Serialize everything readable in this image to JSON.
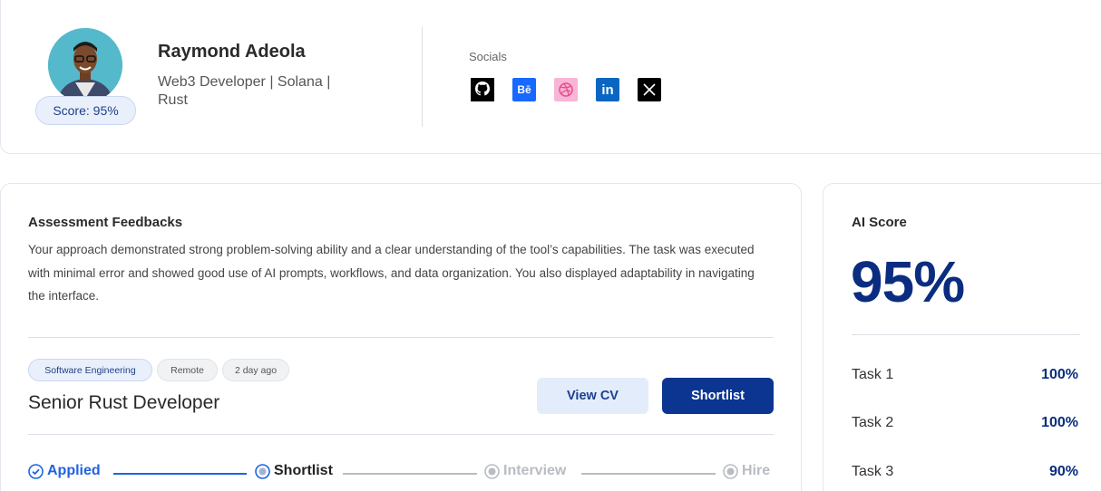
{
  "profile": {
    "name": "Raymond Adeola",
    "role": "Web3 Developer | Solana | Rust",
    "score_badge": "Score: 95%",
    "socials_label": "Socials",
    "socials": [
      "github-icon",
      "behance-icon",
      "dribbble-icon",
      "linkedin-icon",
      "x-icon"
    ],
    "behance_text": "Bē",
    "linkedin_text": "in"
  },
  "assessment": {
    "title": "Assessment Feedbacks",
    "feedback": "Your approach demonstrated strong problem-solving ability and a clear understanding of the tool’s capabilities. The task was executed with minimal error and showed good use of AI prompts, workflows, and data organization. You also displayed adaptability in navigating the interface."
  },
  "job": {
    "tags": [
      "Software Engineering",
      "Remote",
      "2 day ago"
    ],
    "title": "Senior Rust Developer",
    "view_cv_label": "View CV",
    "shortlist_label": "Shortlist"
  },
  "pipeline": {
    "steps": [
      {
        "label": "Applied",
        "state": "done"
      },
      {
        "label": "Shortlist",
        "state": "current"
      },
      {
        "label": "Interview",
        "state": "pending"
      },
      {
        "label": "Hire",
        "state": "pending"
      }
    ]
  },
  "ai_score": {
    "title": "AI Score",
    "value": "95%",
    "tasks": [
      {
        "label": "Task 1",
        "value": "100%"
      },
      {
        "label": "Task 2",
        "value": "100%"
      },
      {
        "label": "Task 3",
        "value": "90%"
      }
    ]
  },
  "colors": {
    "primary": "#0b3591",
    "primary_light": "#e3ecfb",
    "applied": "#1f63e0",
    "pending": "#b9bcc2"
  }
}
